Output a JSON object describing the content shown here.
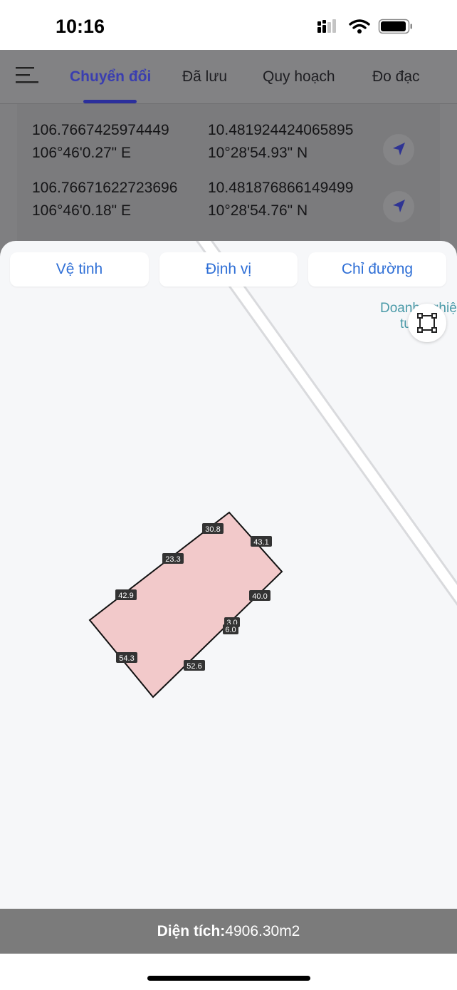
{
  "status_bar": {
    "time": "10:16"
  },
  "nav": {
    "tabs": [
      {
        "label": "Chuyển đổi",
        "active": true
      },
      {
        "label": "Đã lưu",
        "active": false
      },
      {
        "label": "Quy hoạch",
        "active": false
      },
      {
        "label": "Đo đạc",
        "active": false
      }
    ]
  },
  "coords": [
    {
      "lng_dec": "106.7667425974449",
      "lng_dms": "106°46'0.27\" E",
      "lat_dec": "10.481924424065895",
      "lat_dms": "10°28'54.93\" N"
    },
    {
      "lng_dec": "106.76671622723696",
      "lng_dms": "106°46'0.18\" E",
      "lat_dec": "10.481876866149499",
      "lat_dms": "10°28'54.76\" N"
    }
  ],
  "map": {
    "buttons": {
      "satellite": "Vệ tinh",
      "locate": "Định vị",
      "directions": "Chỉ đường"
    },
    "poi_label": {
      "line1": "Doanh nghiệ",
      "line2": "tư HÔ"
    },
    "edge_labels": [
      "30.8",
      "43.1",
      "23.3",
      "42.9",
      "40.0",
      "3.0",
      "6.0",
      "54.3",
      "52.6"
    ],
    "parcel_fill": "#f2c9ca"
  },
  "area": {
    "label": "Diện tích:",
    "value": "4906.30m2"
  },
  "colors": {
    "accent": "#3a3eb0",
    "link": "#2f6fd6"
  }
}
